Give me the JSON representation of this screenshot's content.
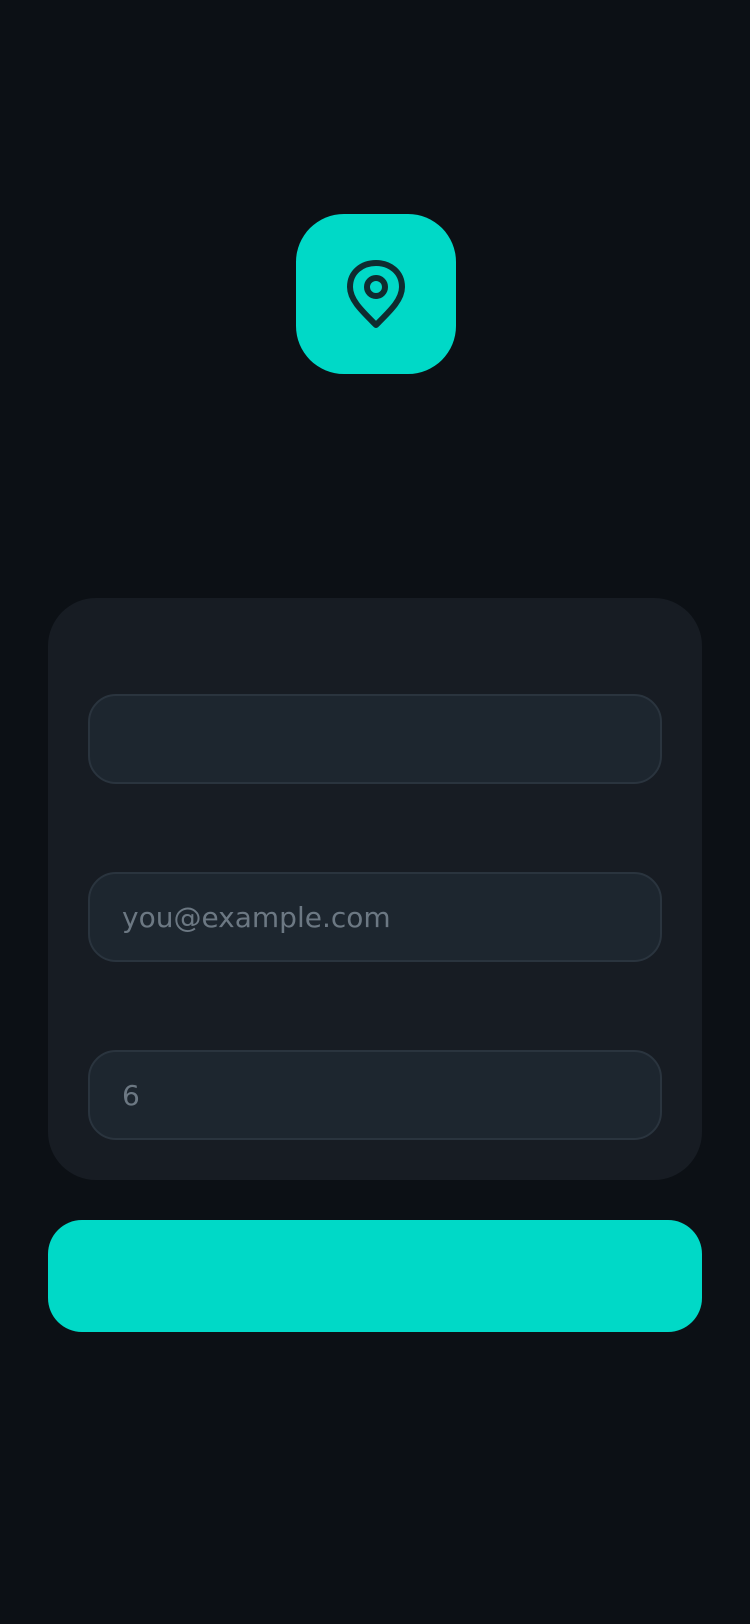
{
  "logo": {
    "icon": "map-pin-icon",
    "background_color": "#00d9c7",
    "icon_color": "#0f2b2f"
  },
  "form": {
    "name_field": {
      "value": "",
      "placeholder": ""
    },
    "email_field": {
      "value": "",
      "placeholder": "you@example.com"
    },
    "count_field": {
      "value": "",
      "placeholder": "6"
    }
  },
  "submit_button": {
    "label": "",
    "background_color": "#00d9c7"
  }
}
